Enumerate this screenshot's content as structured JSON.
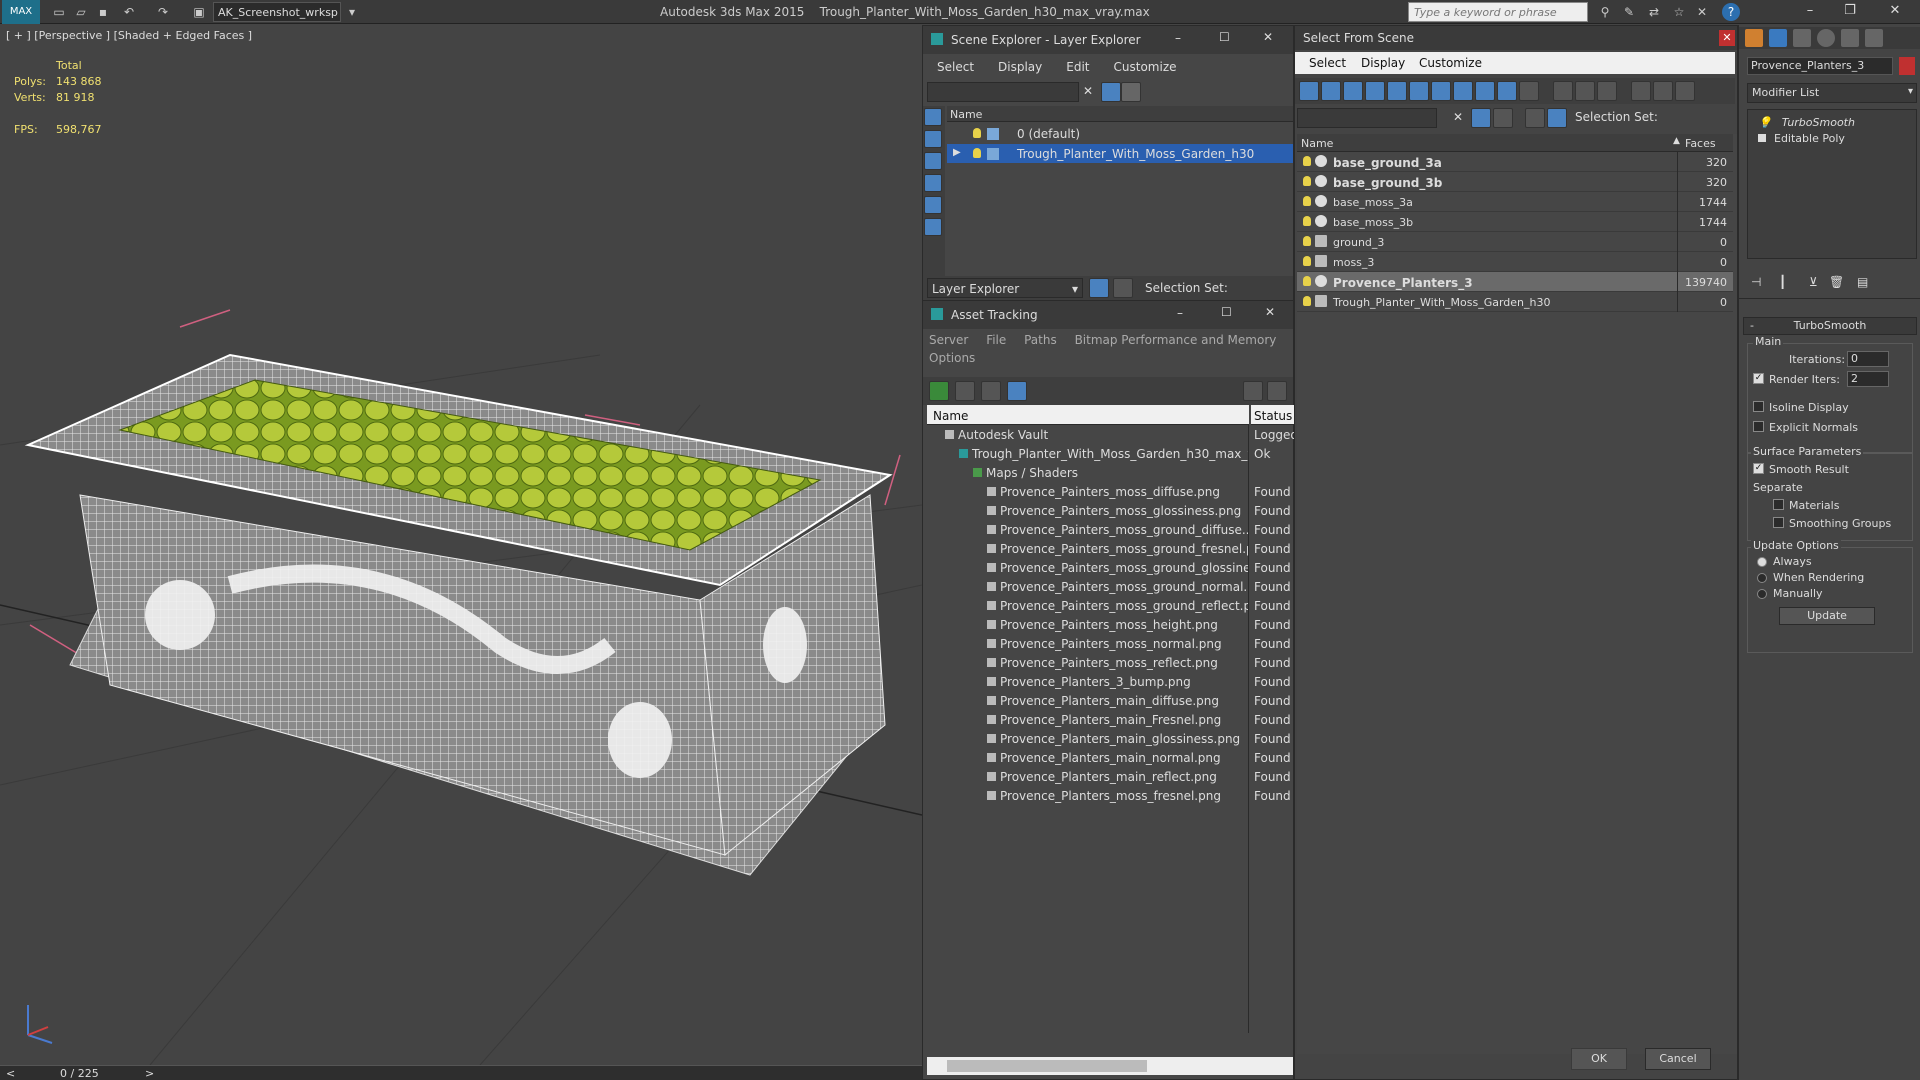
{
  "app": {
    "title": "Autodesk 3ds Max  2015",
    "file": "Trough_Planter_With_Moss_Garden_h30_max_vray.max",
    "workspace": "AK_Screenshot_wrksp",
    "search_placeholder": "Type a keyword or phrase"
  },
  "viewport": {
    "label": "[ + ] [Perspective ] [Shaded + Edged Faces ]",
    "stats_total": "Total",
    "polys_label": "Polys:",
    "polys": "143 868",
    "verts_label": "Verts:",
    "verts": "81 918",
    "fps_label": "FPS:",
    "fps": "598,767",
    "timeline": "0 / 225",
    "prev": "<",
    "next": ">"
  },
  "scene_explorer": {
    "title": "Scene Explorer - Layer Explorer",
    "menu": [
      "Select",
      "Display",
      "Edit",
      "Customize"
    ],
    "col": "Name",
    "rows": [
      "0 (default)",
      "Trough_Planter_With_Moss_Garden_h30"
    ],
    "footer_dropdown": "Layer Explorer",
    "selection_set": "Selection Set:"
  },
  "asset_tracking": {
    "title": "Asset Tracking",
    "menu": [
      "Server",
      "File",
      "Paths",
      "Bitmap Performance and Memory",
      "Options"
    ],
    "col_name": "Name",
    "col_status": "Status",
    "rows": [
      {
        "name": "Autodesk Vault",
        "status": "Logged",
        "indent": 1
      },
      {
        "name": "Trough_Planter_With_Moss_Garden_h30_max_vr...",
        "status": "Ok",
        "indent": 2
      },
      {
        "name": "Maps / Shaders",
        "status": "",
        "indent": 3
      },
      {
        "name": "Provence_Painters_moss_diffuse.png",
        "status": "Found",
        "indent": 4
      },
      {
        "name": "Provence_Painters_moss_glossiness.png",
        "status": "Found",
        "indent": 4
      },
      {
        "name": "Provence_Painters_moss_ground_diffuse....",
        "status": "Found",
        "indent": 4
      },
      {
        "name": "Provence_Painters_moss_ground_fresnel.p...",
        "status": "Found",
        "indent": 4
      },
      {
        "name": "Provence_Painters_moss_ground_glossine...",
        "status": "Found",
        "indent": 4
      },
      {
        "name": "Provence_Painters_moss_ground_normal....",
        "status": "Found",
        "indent": 4
      },
      {
        "name": "Provence_Painters_moss_ground_reflect.p...",
        "status": "Found",
        "indent": 4
      },
      {
        "name": "Provence_Painters_moss_height.png",
        "status": "Found",
        "indent": 4
      },
      {
        "name": "Provence_Painters_moss_normal.png",
        "status": "Found",
        "indent": 4
      },
      {
        "name": "Provence_Painters_moss_reflect.png",
        "status": "Found",
        "indent": 4
      },
      {
        "name": "Provence_Planters_3_bump.png",
        "status": "Found",
        "indent": 4
      },
      {
        "name": "Provence_Planters_main_diffuse.png",
        "status": "Found",
        "indent": 4
      },
      {
        "name": "Provence_Planters_main_Fresnel.png",
        "status": "Found",
        "indent": 4
      },
      {
        "name": "Provence_Planters_main_glossiness.png",
        "status": "Found",
        "indent": 4
      },
      {
        "name": "Provence_Planters_main_normal.png",
        "status": "Found",
        "indent": 4
      },
      {
        "name": "Provence_Planters_main_reflect.png",
        "status": "Found",
        "indent": 4
      },
      {
        "name": "Provence_Planters_moss_fresnel.png",
        "status": "Found",
        "indent": 4
      }
    ]
  },
  "select_from_scene": {
    "title": "Select From Scene",
    "menu": [
      "Select",
      "Display",
      "Customize"
    ],
    "selection_set": "Selection Set:",
    "col_name": "Name",
    "col_faces": "Faces",
    "rows": [
      {
        "name": "base_ground_3a",
        "faces": "320",
        "bold": true,
        "sel": false
      },
      {
        "name": "base_ground_3b",
        "faces": "320",
        "bold": true,
        "sel": false
      },
      {
        "name": "base_moss_3a",
        "faces": "1744",
        "bold": false,
        "sel": false
      },
      {
        "name": "base_moss_3b",
        "faces": "1744",
        "bold": false,
        "sel": false
      },
      {
        "name": "ground_3",
        "faces": "0",
        "bold": false,
        "sel": false
      },
      {
        "name": "moss_3",
        "faces": "0",
        "bold": false,
        "sel": false
      },
      {
        "name": "Provence_Planters_3",
        "faces": "139740",
        "bold": true,
        "sel": true
      },
      {
        "name": "Trough_Planter_With_Moss_Garden_h30",
        "faces": "0",
        "bold": false,
        "sel": false
      }
    ],
    "ok": "OK",
    "cancel": "Cancel"
  },
  "modify": {
    "object_name": "Provence_Planters_3",
    "modifier_list": "Modifier List",
    "stack": [
      "TurboSmooth",
      "Editable Poly"
    ],
    "rollout": "TurboSmooth",
    "main": "Main",
    "iterations_label": "Iterations:",
    "iterations": "0",
    "render_iters_label": "Render Iters:",
    "render_iters": "2",
    "isoline": "Isoline Display",
    "explicit": "Explicit Normals",
    "surface": "Surface Parameters",
    "smooth_result": "Smooth Result",
    "separate": "Separate",
    "materials": "Materials",
    "smoothing_groups": "Smoothing Groups",
    "update_options": "Update Options",
    "always": "Always",
    "when_rendering": "When Rendering",
    "manually": "Manually",
    "update": "Update"
  }
}
